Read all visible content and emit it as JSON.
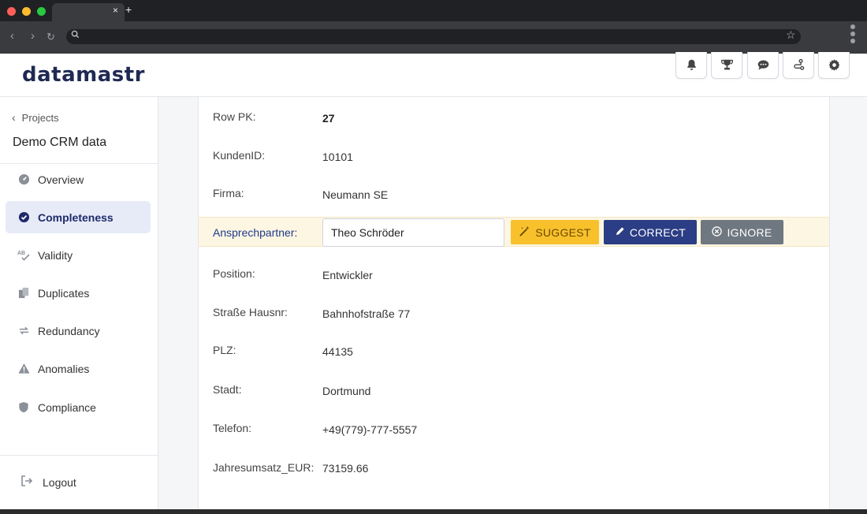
{
  "browser": {
    "tab_close": "×",
    "tab_new": "+"
  },
  "header": {
    "logo": "datamastr",
    "icons": [
      "bell-icon",
      "trophy-icon",
      "chat-icon",
      "workflow-icon",
      "gear-icon"
    ]
  },
  "sidebar": {
    "back_label": "Projects",
    "project_name": "Demo CRM data",
    "items": [
      {
        "label": "Overview",
        "icon": "dashboard-icon",
        "active": false
      },
      {
        "label": "Completeness",
        "icon": "check-circle-icon",
        "active": true
      },
      {
        "label": "Validity",
        "icon": "spellcheck-icon",
        "active": false
      },
      {
        "label": "Duplicates",
        "icon": "copy-icon",
        "active": false
      },
      {
        "label": "Redundancy",
        "icon": "sync-icon",
        "active": false
      },
      {
        "label": "Anomalies",
        "icon": "warning-icon",
        "active": false
      },
      {
        "label": "Compliance",
        "icon": "shield-icon",
        "active": false
      }
    ],
    "logout_label": "Logout"
  },
  "record": {
    "fields": [
      {
        "label": "Row PK:",
        "value": "27"
      },
      {
        "label": "KundenID:",
        "value": "10101"
      },
      {
        "label": "Firma:",
        "value": "Neumann SE"
      },
      {
        "label": "Ansprechpartner:",
        "value": "Theo Schröder"
      },
      {
        "label": "Position:",
        "value": "Entwickler"
      },
      {
        "label": "Straße Hausnr:",
        "value": "Bahnhofstraße 77"
      },
      {
        "label": "PLZ:",
        "value": "44135"
      },
      {
        "label": "Stadt:",
        "value": "Dortmund"
      },
      {
        "label": "Telefon:",
        "value": "+49(779)-777-5557"
      },
      {
        "label": "Jahresumsatz_EUR:",
        "value": "73159.66"
      }
    ],
    "actions": {
      "suggest": "SUGGEST",
      "correct": "CORRECT",
      "ignore": "IGNORE"
    }
  },
  "colors": {
    "brand": "#1f2a53",
    "suggest": "#f8c12c",
    "correct": "#2b3d84",
    "ignore": "#6f7780",
    "highlight_row": "#fdf6e3"
  }
}
